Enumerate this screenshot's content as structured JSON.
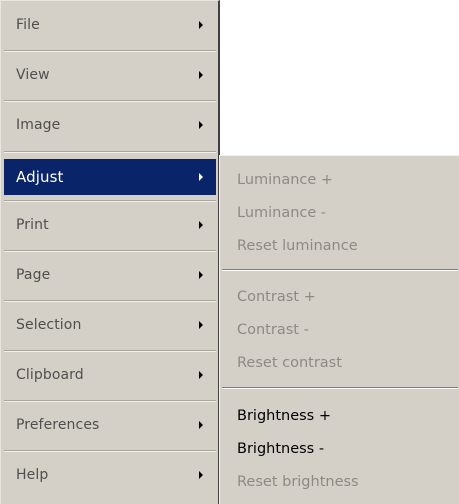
{
  "main_menu": {
    "items": [
      {
        "label": "File",
        "active": false
      },
      {
        "label": "View",
        "active": false
      },
      {
        "label": "Image",
        "active": false
      },
      {
        "label": "Adjust",
        "active": true
      },
      {
        "label": "Print",
        "active": false
      },
      {
        "label": "Page",
        "active": false
      },
      {
        "label": "Selection",
        "active": false
      },
      {
        "label": "Clipboard",
        "active": false
      },
      {
        "label": "Preferences",
        "active": false
      },
      {
        "label": "Help",
        "active": false
      }
    ]
  },
  "adjust_submenu": {
    "items": [
      {
        "label": "Luminance +",
        "enabled": false
      },
      {
        "label": "Luminance -",
        "enabled": false
      },
      {
        "label": "Reset luminance",
        "enabled": false
      },
      {
        "label": "Contrast +",
        "enabled": false
      },
      {
        "label": "Contrast -",
        "enabled": false
      },
      {
        "label": "Reset contrast",
        "enabled": false
      },
      {
        "label": "Brightness +",
        "enabled": true
      },
      {
        "label": "Brightness -",
        "enabled": true
      },
      {
        "label": "Reset brightness",
        "enabled": false
      }
    ]
  },
  "colors": {
    "menu_background": "#d4d0c8",
    "highlight": "#0a246a",
    "disabled_text": "#8d8a84"
  }
}
